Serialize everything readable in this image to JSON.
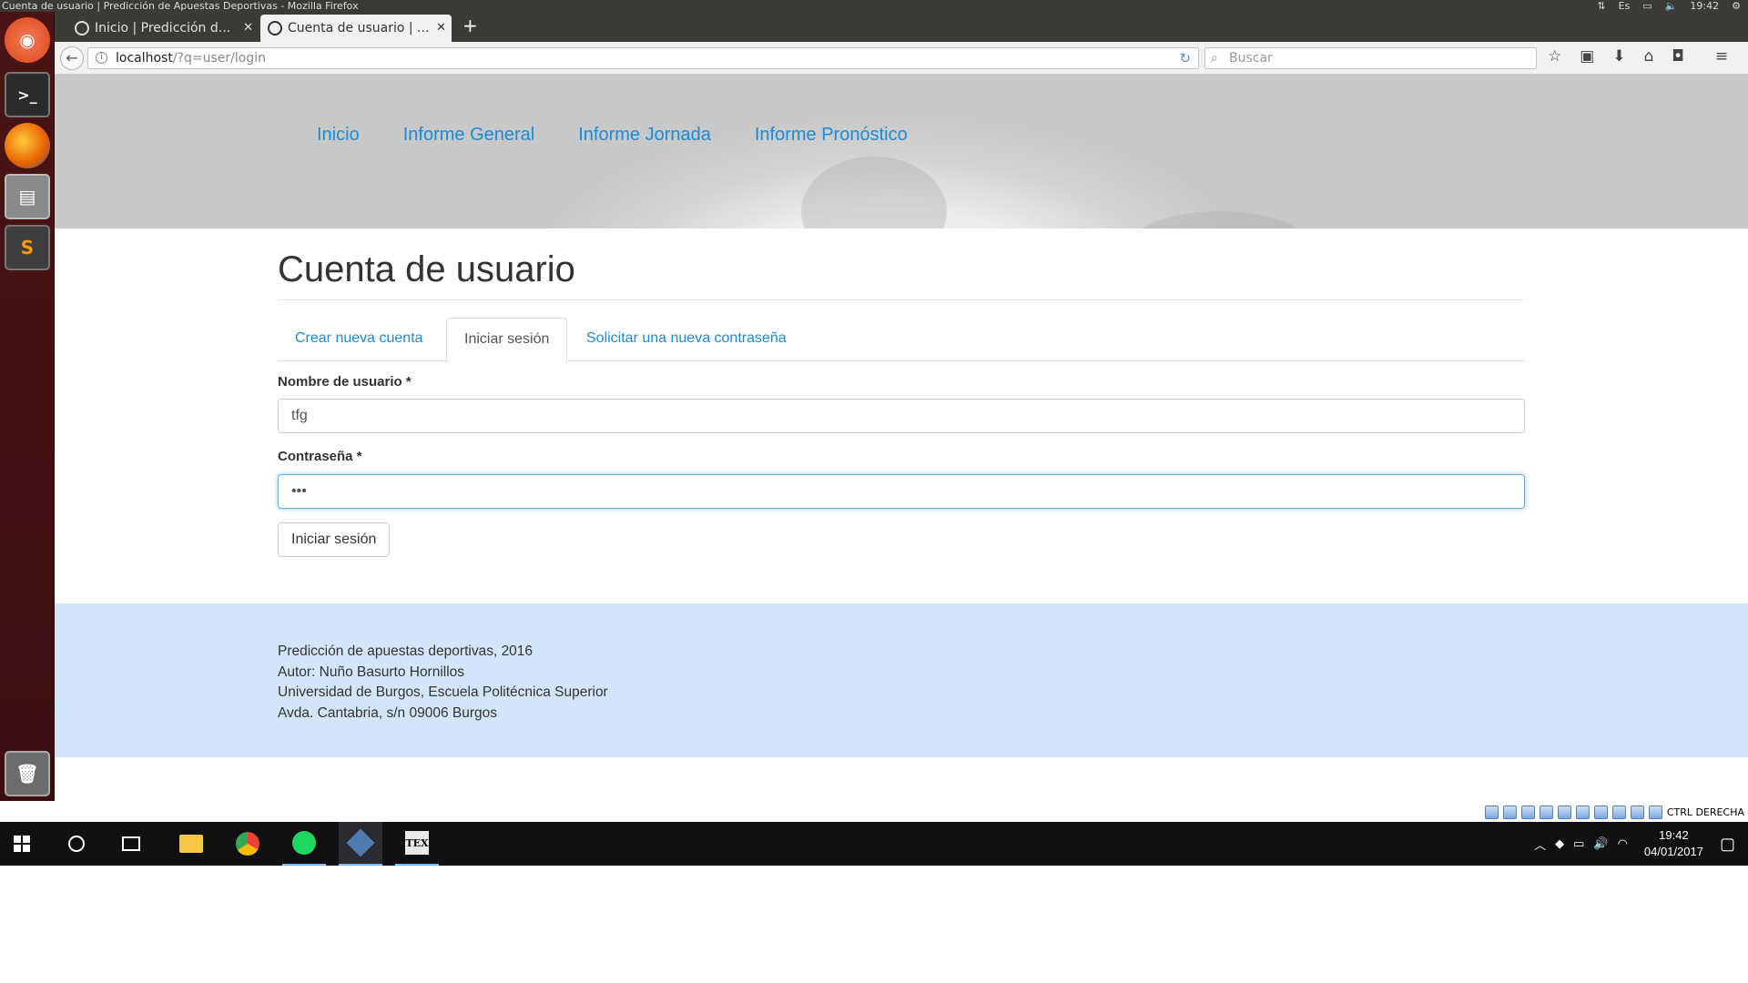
{
  "window": {
    "title": "Cuenta de usuario | Predicción de Apuestas Deportivas - Mozilla Firefox"
  },
  "indicators": {
    "keyboard": "Es",
    "time": "19:42"
  },
  "browser": {
    "tabs": [
      {
        "label": "Inicio | Predicción d..."
      },
      {
        "label": "Cuenta de usuario | ..."
      }
    ],
    "url_host": "localhost",
    "url_path": "/?q=user/login",
    "search_placeholder": "Buscar"
  },
  "site": {
    "menu": [
      "Inicio",
      "Informe General",
      "Informe Jornada",
      "Informe Pronóstico"
    ],
    "page_title": "Cuenta de usuario",
    "tabs": [
      "Crear nueva cuenta",
      "Iniciar sesión",
      "Solicitar una nueva contraseña"
    ],
    "active_tab": "Iniciar sesión",
    "form": {
      "username_label": "Nombre de usuario *",
      "username_value": "tfg",
      "password_label": "Contraseña *",
      "password_value": "•••",
      "submit_label": "Iniciar sesión"
    },
    "footer": [
      "Predicción de apuestas deportivas, 2016",
      "Autor: Nuño Basurto Hornillos",
      "Universidad de Burgos, Escuela Politécnica Superior",
      "Avda. Cantabria, s/n 09006 Burgos"
    ]
  },
  "vbox_status": {
    "host_key": "CTRL DERECHA"
  },
  "taskbar": {
    "time": "19:42",
    "date": "04/01/2017"
  },
  "colors": {
    "link": "#1a8bd6",
    "footer_bg": "#d2e6f8",
    "launcher": "#4a1414"
  }
}
